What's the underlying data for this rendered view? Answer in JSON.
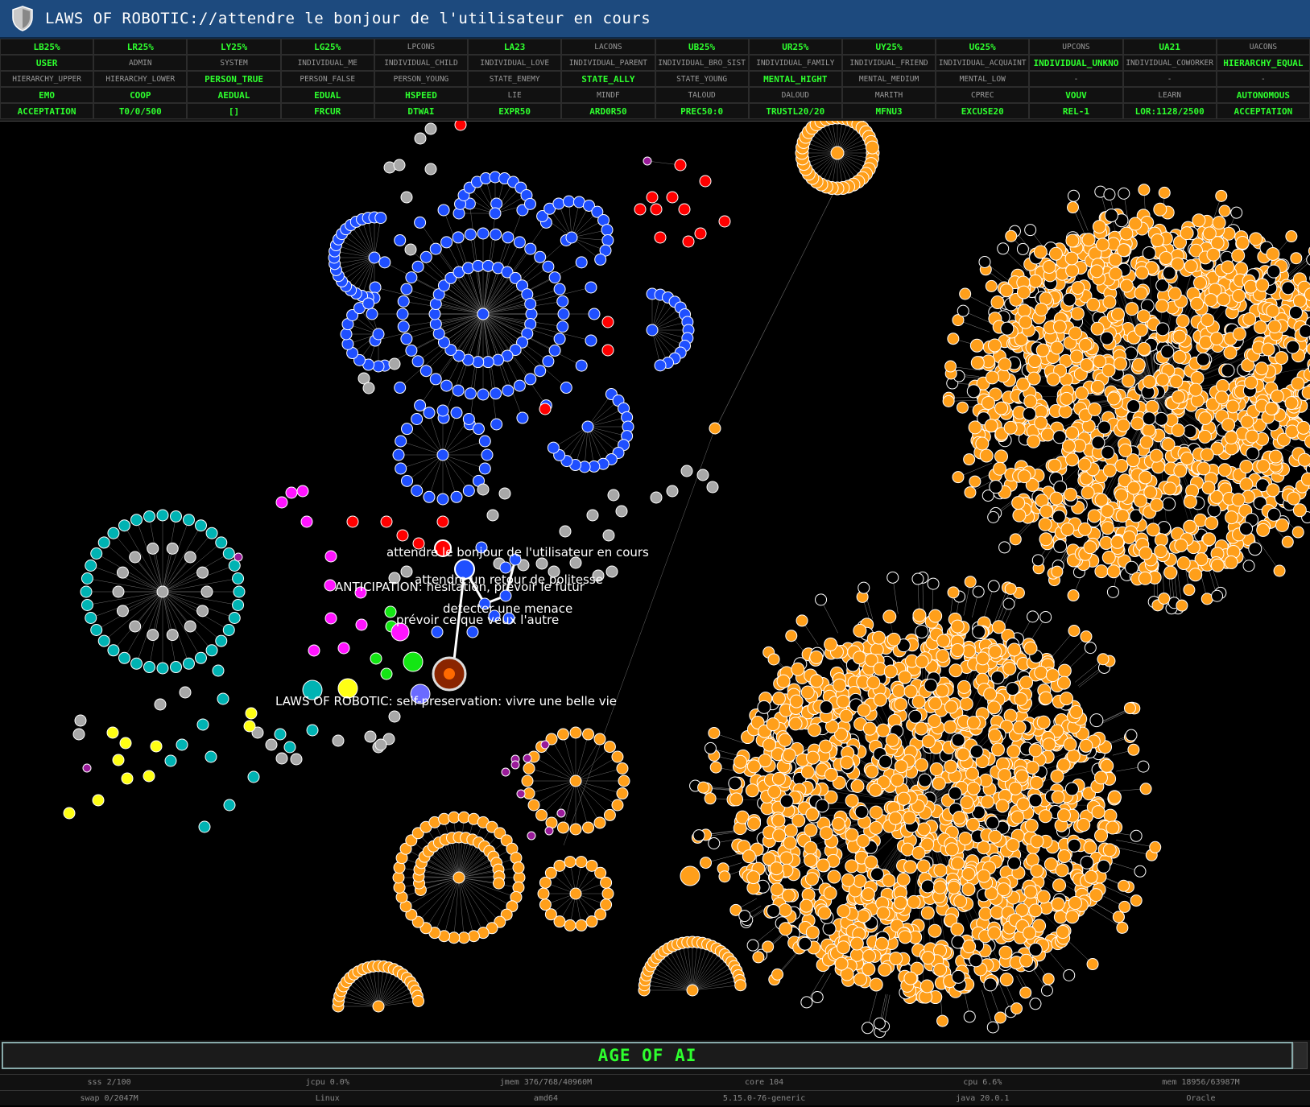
{
  "window": {
    "title": "LAWS OF ROBOTIC://attendre le bonjour de l'utilisateur en cours",
    "icon": "shield-icon"
  },
  "status_grid": [
    [
      {
        "t": "LB25%",
        "on": true
      },
      {
        "t": "LR25%",
        "on": true
      },
      {
        "t": "LY25%",
        "on": true
      },
      {
        "t": "LG25%",
        "on": true
      },
      {
        "t": "LPCONS",
        "on": false
      },
      {
        "t": "LA23",
        "on": true
      },
      {
        "t": "LACONS",
        "on": false
      },
      {
        "t": "UB25%",
        "on": true
      },
      {
        "t": "UR25%",
        "on": true
      },
      {
        "t": "UY25%",
        "on": true
      },
      {
        "t": "UG25%",
        "on": true
      },
      {
        "t": "UPCONS",
        "on": false
      },
      {
        "t": "UA21",
        "on": true
      },
      {
        "t": "UACONS",
        "on": false
      }
    ],
    [
      {
        "t": "USER",
        "on": true
      },
      {
        "t": "ADMIN",
        "on": false
      },
      {
        "t": "SYSTEM",
        "on": false
      },
      {
        "t": "INDIVIDUAL_ME",
        "on": false
      },
      {
        "t": "INDIVIDUAL_CHILD",
        "on": false
      },
      {
        "t": "INDIVIDUAL_LOVE",
        "on": false
      },
      {
        "t": "INDIVIDUAL_PARENT",
        "on": false
      },
      {
        "t": "INDIVIDUAL_BRO_SIST",
        "on": false
      },
      {
        "t": "INDIVIDUAL_FAMILY",
        "on": false
      },
      {
        "t": "INDIVIDUAL_FRIEND",
        "on": false
      },
      {
        "t": "INDIVIDUAL_ACQUAINT",
        "on": false
      },
      {
        "t": "INDIVIDUAL_UNKNO",
        "on": true
      },
      {
        "t": "INDIVIDUAL_COWORKER",
        "on": false
      },
      {
        "t": "HIERARCHY_EQUAL",
        "on": true
      }
    ],
    [
      {
        "t": "HIERARCHY_UPPER",
        "on": false
      },
      {
        "t": "HIERARCHY_LOWER",
        "on": false
      },
      {
        "t": "PERSON_TRUE",
        "on": true
      },
      {
        "t": "PERSON_FALSE",
        "on": false
      },
      {
        "t": "PERSON_YOUNG",
        "on": false
      },
      {
        "t": "STATE_ENEMY",
        "on": false
      },
      {
        "t": "STATE_ALLY",
        "on": true
      },
      {
        "t": "STATE_YOUNG",
        "on": false
      },
      {
        "t": "MENTAL_HIGHT",
        "on": true
      },
      {
        "t": "MENTAL_MEDIUM",
        "on": false
      },
      {
        "t": "MENTAL_LOW",
        "on": false
      },
      {
        "t": "-",
        "on": false
      },
      {
        "t": "-",
        "on": false
      },
      {
        "t": "-",
        "on": false
      }
    ],
    [
      {
        "t": "EMO",
        "on": true
      },
      {
        "t": "COOP",
        "on": true
      },
      {
        "t": "AEDUAL",
        "on": true
      },
      {
        "t": "EDUAL",
        "on": true
      },
      {
        "t": "HSPEED",
        "on": true
      },
      {
        "t": "LIE",
        "on": false
      },
      {
        "t": "MINDF",
        "on": false
      },
      {
        "t": "TALOUD",
        "on": false
      },
      {
        "t": "DALOUD",
        "on": false
      },
      {
        "t": "MARITH",
        "on": false
      },
      {
        "t": "CPREC",
        "on": false
      },
      {
        "t": "VOUV",
        "on": true
      },
      {
        "t": "LEARN",
        "on": false
      },
      {
        "t": "AUTONOMOUS",
        "on": true
      }
    ],
    [
      {
        "t": "ACCEPTATION",
        "on": true
      },
      {
        "t": "T0/0/500",
        "on": true
      },
      {
        "t": "[]",
        "on": true
      },
      {
        "t": "FRCUR",
        "on": true
      },
      {
        "t": "DTWAI",
        "on": true
      },
      {
        "t": "EXPR50",
        "on": true
      },
      {
        "t": "ARD0R50",
        "on": true
      },
      {
        "t": "PREC50:0",
        "on": true
      },
      {
        "t": "TRUSTL20/20",
        "on": true
      },
      {
        "t": "MFNU3",
        "on": true
      },
      {
        "t": "EXCUSE20",
        "on": true
      },
      {
        "t": "REL-1",
        "on": true
      },
      {
        "t": "LOR:1128/2500",
        "on": true
      },
      {
        "t": "ACCEPTATION",
        "on": true
      }
    ]
  ],
  "graph": {
    "labels": [
      "attendre le bonjour de l'utilisateur en cours",
      "attendre un retour de politesse",
      "ANTICIPATION: hesitation, prévoir le futur",
      "detecter une menace",
      "prévoir ce que veux l'autre",
      "LAWS OF ROBOTIC: self-preservation: vivre une belle vie"
    ],
    "colors": {
      "orange": "#ff9f1a",
      "blue": "#1f4fff",
      "red": "#ff0000",
      "cyan": "#00b3b3",
      "gray": "#a8a8a8",
      "magenta": "#ff14ff",
      "yellow": "#ffff14",
      "green": "#14e614",
      "purple": "#9a1b9a",
      "core": "#7a1a00"
    }
  },
  "footer": {
    "banner": "AGE OF AI",
    "row1": [
      "sss 2/100",
      "jcpu 0.0%",
      "jmem 376/768/40960M",
      "core 104",
      "cpu 6.6%",
      "mem 18956/63987M"
    ],
    "row2": [
      "swap 0/2047M",
      "Linux",
      "amd64",
      "5.15.0-76-generic",
      "java 20.0.1",
      "Oracle"
    ]
  }
}
